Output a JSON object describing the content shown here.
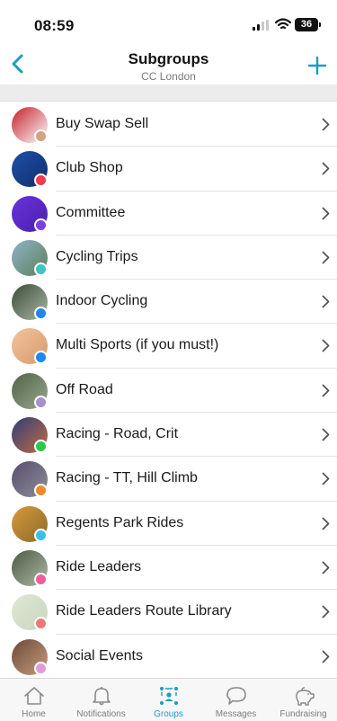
{
  "status_bar": {
    "time": "08:59",
    "battery": "36"
  },
  "header": {
    "title": "Subgroups",
    "subtitle": "CC London"
  },
  "subgroups": [
    {
      "label": "Buy Swap Sell",
      "dot_color": "#d2a37f",
      "avatar_colors": [
        "#c4202b",
        "#ffffff"
      ]
    },
    {
      "label": "Club Shop",
      "dot_color": "#ef3d4a",
      "avatar_colors": [
        "#1f4fa8",
        "#0f2f6e"
      ]
    },
    {
      "label": "Committee",
      "dot_color": "#7c3fe0",
      "avatar_colors": [
        "#6a32d8",
        "#4a1fb0"
      ]
    },
    {
      "label": "Cycling Trips",
      "dot_color": "#3cc3c3",
      "avatar_colors": [
        "#8fb3c9",
        "#5e7f59"
      ]
    },
    {
      "label": "Indoor Cycling",
      "dot_color": "#1f87f0",
      "avatar_colors": [
        "#3b4b3a",
        "#a9b7a1"
      ]
    },
    {
      "label": "Multi Sports (if you must!)",
      "dot_color": "#1f87f0",
      "avatar_colors": [
        "#f1c39e",
        "#d99a6c"
      ]
    },
    {
      "label": "Off Road",
      "dot_color": "#a88fd0",
      "avatar_colors": [
        "#4e6446",
        "#9aa58d"
      ]
    },
    {
      "label": "Racing - Road, Crit",
      "dot_color": "#2bc84a",
      "avatar_colors": [
        "#2b3f7a",
        "#c46b3e"
      ]
    },
    {
      "label": "Racing - TT, Hill Climb",
      "dot_color": "#f08a28",
      "avatar_colors": [
        "#5a4c6e",
        "#8a8f98"
      ]
    },
    {
      "label": "Regents Park Rides",
      "dot_color": "#3bbfe9",
      "avatar_colors": [
        "#d79a3a",
        "#8a6a2c"
      ]
    },
    {
      "label": "Ride Leaders",
      "dot_color": "#f05c9e",
      "avatar_colors": [
        "#4a5b43",
        "#b0b7a5"
      ]
    },
    {
      "label": "Ride Leaders Route Library",
      "dot_color": "#ea7a7a",
      "avatar_colors": [
        "#dfe7d6",
        "#c9d7bd"
      ]
    },
    {
      "label": "Social Events",
      "dot_color": "#e39ad8",
      "avatar_colors": [
        "#6b4a3a",
        "#c79b7a"
      ]
    }
  ],
  "tabs": [
    {
      "label": "Home",
      "icon": "home-icon",
      "active": false
    },
    {
      "label": "Notifications",
      "icon": "bell-icon",
      "active": false
    },
    {
      "label": "Groups",
      "icon": "groups-icon",
      "active": true
    },
    {
      "label": "Messages",
      "icon": "chat-bubble-icon",
      "active": false
    },
    {
      "label": "Fundraising",
      "icon": "piggy-bank-icon",
      "active": false
    }
  ],
  "colors": {
    "accent": "#1a9dc0",
    "separator": "#e3e3e3",
    "band": "#ececec"
  }
}
